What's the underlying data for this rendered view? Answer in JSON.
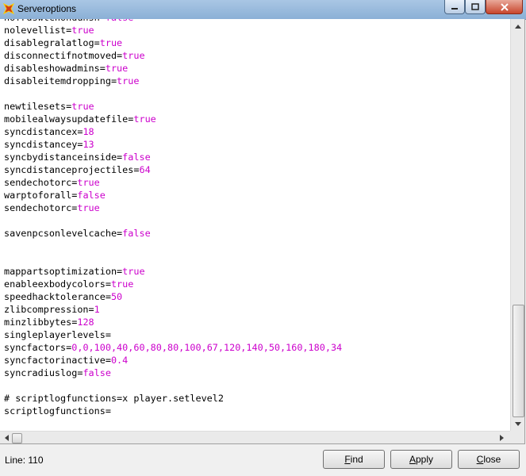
{
  "window": {
    "title": "Serveroptions",
    "icon": "app-logo-icon"
  },
  "editor": {
    "lines": [
      {
        "k": "nofrdswtchonduhsh=",
        "v": "false"
      },
      {
        "k": "nolevellist=",
        "v": "true"
      },
      {
        "k": "disablegralatlog=",
        "v": "true"
      },
      {
        "k": "disconnectifnotmoved=",
        "v": "true"
      },
      {
        "k": "disableshowadmins=",
        "v": "true"
      },
      {
        "k": "disableitemdropping=",
        "v": "true"
      },
      {
        "k": "",
        "v": ""
      },
      {
        "k": "newtilesets=",
        "v": "true"
      },
      {
        "k": "mobilealwaysupdatefile=",
        "v": "true"
      },
      {
        "k": "syncdistancex=",
        "v": "18"
      },
      {
        "k": "syncdistancey=",
        "v": "13"
      },
      {
        "k": "syncbydistanceinside=",
        "v": "false"
      },
      {
        "k": "syncdistanceprojectiles=",
        "v": "64"
      },
      {
        "k": "sendechotorc=",
        "v": "true"
      },
      {
        "k": "warptoforall=",
        "v": "false"
      },
      {
        "k": "sendechotorc=",
        "v": "true"
      },
      {
        "k": "",
        "v": ""
      },
      {
        "k": "savenpcsonlevelcache=",
        "v": "false"
      },
      {
        "k": "",
        "v": ""
      },
      {
        "k": "",
        "v": ""
      },
      {
        "k": "mappartsoptimization=",
        "v": "true"
      },
      {
        "k": "enableexbodycolors=",
        "v": "true"
      },
      {
        "k": "speedhacktolerance=",
        "v": "50"
      },
      {
        "k": "zlibcompression=",
        "v": "1"
      },
      {
        "k": "minzlibbytes=",
        "v": "128"
      },
      {
        "k": "singleplayerlevels=",
        "v": ""
      },
      {
        "k": "syncfactors=",
        "v": "0,0,100,40,60,80,80,100,67,120,140,50,160,180,34"
      },
      {
        "k": "syncfactorinactive=",
        "v": "0.4"
      },
      {
        "k": "syncradiuslog=",
        "v": "false"
      },
      {
        "k": "",
        "v": ""
      },
      {
        "k": "# scriptlogfunctions=x player.setlevel2",
        "v": ""
      },
      {
        "k": "scriptlogfunctions=",
        "v": ""
      }
    ]
  },
  "status": {
    "line_label": "Line: 110"
  },
  "buttons": {
    "find": {
      "first": "F",
      "rest": "ind"
    },
    "apply": {
      "first": "A",
      "rest": "pply"
    },
    "close": {
      "first": "C",
      "rest": "lose"
    }
  },
  "colors": {
    "value": "#cc00cc",
    "key": "#000000",
    "titlebar": "#a9c6e4",
    "close_button": "#c8452c"
  }
}
